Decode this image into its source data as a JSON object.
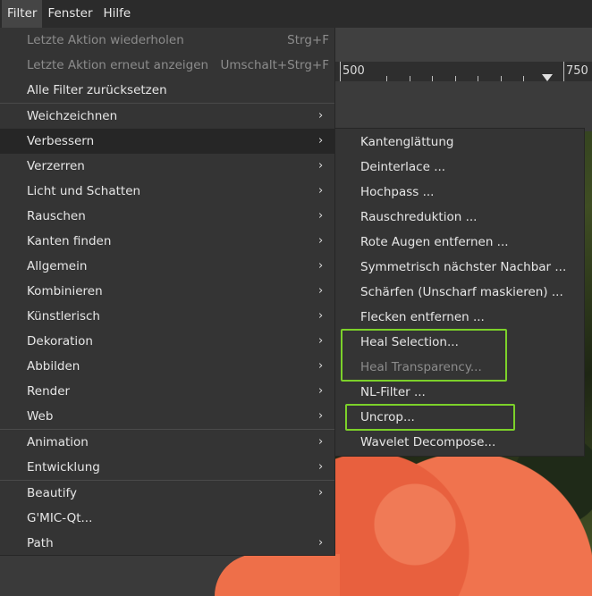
{
  "menubar": {
    "items": [
      {
        "label": "Filter",
        "active": true
      },
      {
        "label": "Fenster",
        "active": false
      },
      {
        "label": "Hilfe",
        "active": false
      }
    ]
  },
  "ruler": {
    "labels": [
      "500",
      "750"
    ]
  },
  "filter_menu": {
    "items": [
      {
        "label": "Letzte Aktion wiederholen",
        "shortcut": "Strg+F",
        "disabled": true
      },
      {
        "label": "Letzte Aktion erneut anzeigen",
        "shortcut": "Umschalt+Strg+F",
        "disabled": true
      },
      {
        "label": "Alle Filter zurücksetzen"
      },
      {
        "label": "Weichzeichnen",
        "submenu": true
      },
      {
        "label": "Verbessern",
        "submenu": true,
        "highlighted": true
      },
      {
        "label": "Verzerren",
        "submenu": true
      },
      {
        "label": "Licht und Schatten",
        "submenu": true
      },
      {
        "label": "Rauschen",
        "submenu": true
      },
      {
        "label": "Kanten finden",
        "submenu": true
      },
      {
        "label": "Allgemein",
        "submenu": true
      },
      {
        "label": "Kombinieren",
        "submenu": true
      },
      {
        "label": "Künstlerisch",
        "submenu": true
      },
      {
        "label": "Dekoration",
        "submenu": true
      },
      {
        "label": "Abbilden",
        "submenu": true
      },
      {
        "label": "Render",
        "submenu": true
      },
      {
        "label": "Web",
        "submenu": true
      },
      {
        "label": "Animation",
        "submenu": true
      },
      {
        "label": "Entwicklung",
        "submenu": true
      },
      {
        "label": "Beautify",
        "submenu": true
      },
      {
        "label": "G'MIC-Qt..."
      },
      {
        "label": "Path",
        "submenu": true
      }
    ]
  },
  "verbessern_submenu": {
    "items": [
      {
        "label": "Kantenglättung"
      },
      {
        "label": "Deinterlace ..."
      },
      {
        "label": "Hochpass ..."
      },
      {
        "label": "Rauschreduktion ..."
      },
      {
        "label": "Rote Augen entfernen ..."
      },
      {
        "label": "Symmetrisch nächster Nachbar ..."
      },
      {
        "label": "Schärfen (Unscharf maskieren) ..."
      },
      {
        "label": "Flecken entfernen ..."
      },
      {
        "label": "Heal Selection..."
      },
      {
        "label": "Heal Transparency...",
        "disabled": true
      },
      {
        "label": "NL-Filter ..."
      },
      {
        "label": "Uncrop..."
      },
      {
        "label": "Wavelet Decompose..."
      }
    ]
  },
  "colors": {
    "highlight_box": "#7cd12a",
    "menu_bg": "#343434",
    "active_item_bg": "#262626"
  },
  "icons": {
    "submenu_arrow": "chevron-right-icon"
  }
}
